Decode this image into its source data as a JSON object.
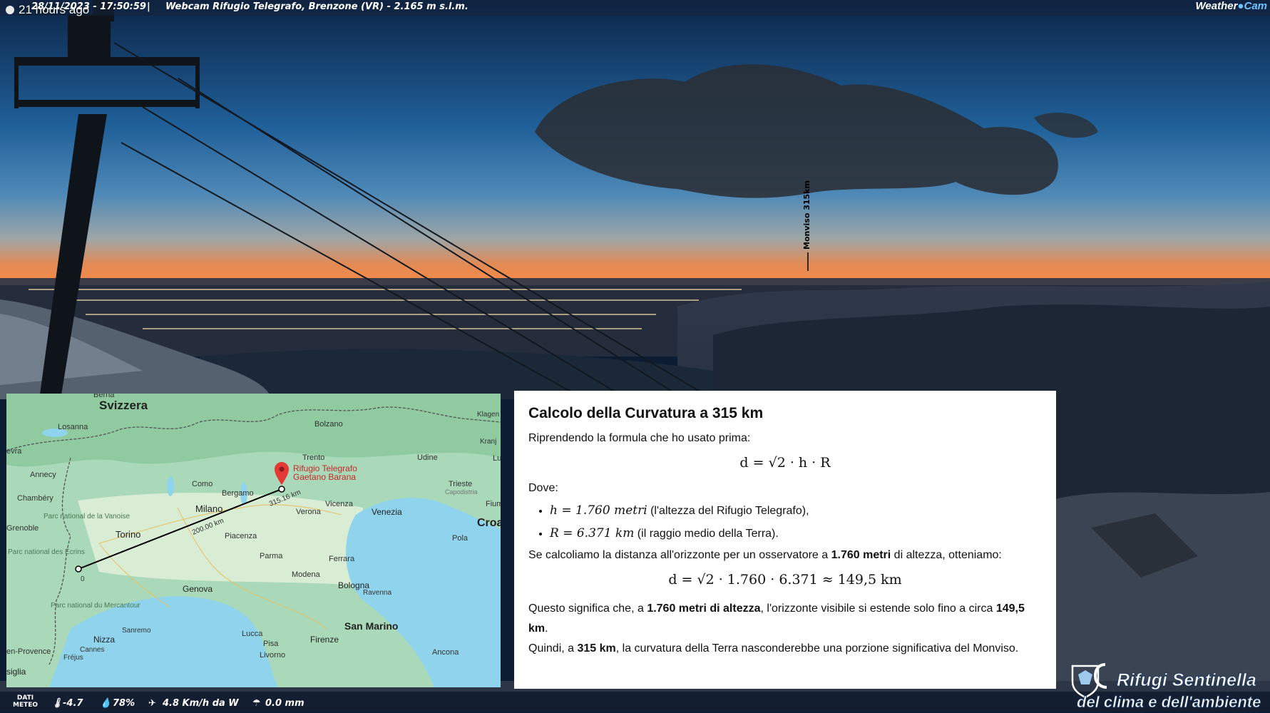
{
  "header": {
    "time_ago": "21 hours ago",
    "timestamp": "28/11/2023 - 17:50:59",
    "separator": "|",
    "title": "Webcam Rifugio Telegrafo, Brenzone (VR) - 2.165 m s.l.m.",
    "brand_weather": "Weather",
    "brand_cam": "Cam"
  },
  "scene": {
    "peak_label": "Monviso 315km"
  },
  "map": {
    "labels": {
      "switzerland": "Svizzera",
      "berna": "Berna",
      "losanna": "Losanna",
      "ginevra": "evra",
      "annecy": "Annecy",
      "chambery": "Chambéry",
      "grenoble": "Grenoble",
      "vanoise": "Parc national de la Vanoise",
      "ecrins": "Parc national des Écrins",
      "mercantour": "Parc national du Mercantour",
      "como": "Como",
      "bergamo": "Bergamo",
      "milano": "Milano",
      "torino": "Torino",
      "piacenza": "Piacenza",
      "parma": "Parma",
      "modena": "Modena",
      "bologna": "Bologna",
      "genova": "Genova",
      "sanremo": "Sanremo",
      "nizza": "Nizza",
      "cannes": "Cannes",
      "frejus": "Fréjus",
      "provence": "en-Provence",
      "sicilia": "siglia",
      "lucca": "Lucca",
      "pisa": "Pisa",
      "livorno": "Livorno",
      "firenze": "Firenze",
      "san_marino": "San Marino",
      "ancona": "Ancona",
      "ravenna": "Ravenna",
      "ferrara": "Ferrara",
      "verona": "Verona",
      "vicenza": "Vicenza",
      "venezia": "Venezia",
      "trento": "Trento",
      "bolzano": "Bolzano",
      "udine": "Udine",
      "trieste": "Trieste",
      "capodistria": "Capodistria",
      "pola": "Pola",
      "fiume": "Fium",
      "croazia": "Croa",
      "kranj": "Kranj",
      "klagenfurt": "Klagen Wörthe",
      "lubiana": "Lu",
      "rifugio1": "Rifugio Telegrafo",
      "rifugio2": "Gaetano Barana",
      "dist1": "315.16 km",
      "dist2": "200.00 km",
      "zero": "0"
    }
  },
  "info": {
    "title": "Calcolo della Curvatura a 315 km",
    "intro": "Riprendendo la formula che ho usato prima:",
    "formula1": "d = √2 · h · R",
    "dove": "Dove:",
    "item1_math": "h = 1.760 metri",
    "item1_text": " (l'altezza del Rifugio Telegrafo),",
    "item2_math": "R = 6.371 km",
    "item2_text": " (il raggio medio della Terra).",
    "p2_a": "Se calcoliamo la distanza all'orizzonte per un osservatore a ",
    "p2_b": "1.760 metri",
    "p2_c": " di altezza, otteniamo:",
    "formula2": "d = √2 · 1.760 · 6.371 ≈ 149,5 km",
    "p3_a": "Questo significa che, a ",
    "p3_b": "1.760 metri di altezza",
    "p3_c": ", l'orizzonte visibile si estende solo fino a circa ",
    "p3_d": "149,5 km",
    "p3_e": ".",
    "p4_a": "Quindi, a ",
    "p4_b": "315 km",
    "p4_c": ", la curvatura della Terra nasconderebbe una porzione significativa del Monviso."
  },
  "weather": {
    "label_line1": "DATI",
    "label_line2": "METEO",
    "temperature": "-4.7",
    "humidity": "78%",
    "wind": "4.8 Km/h da W",
    "rain": "0.0 mm"
  },
  "logo": {
    "line1": "Rifugi Sentinella",
    "line2": "del clima e dell'ambiente"
  }
}
